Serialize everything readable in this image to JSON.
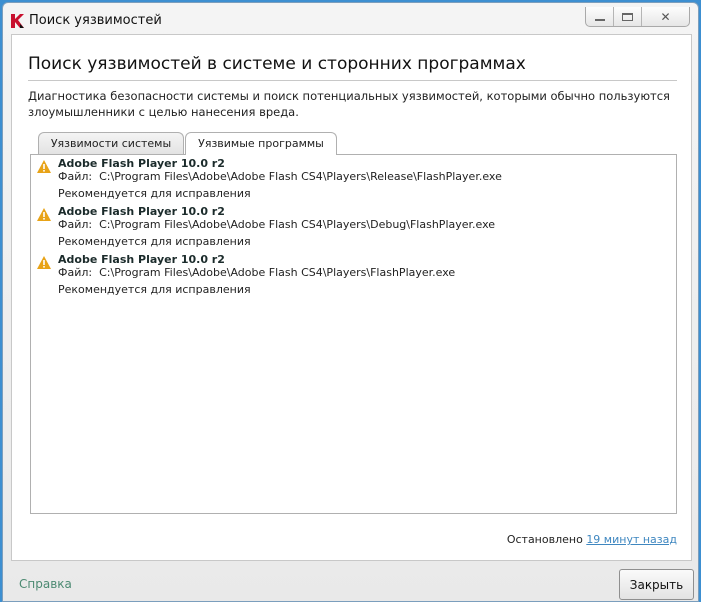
{
  "window": {
    "title": "Поиск уязвимостей"
  },
  "header": {
    "title": "Поиск уязвимостей в системе и сторонних программах",
    "description": "Диагностика безопасности системы и поиск потенциальных уязвимостей, которыми обычно пользуются злоумышленники с целью нанесения вреда."
  },
  "tabs": [
    {
      "label": "Уязвимости системы"
    },
    {
      "label": "Уязвимые программы",
      "active": true
    }
  ],
  "items": [
    {
      "name": "Adobe Flash Player 10.0 r2",
      "file_label": "Файл:",
      "path": "C:\\Program Files\\Adobe\\Adobe Flash CS4\\Players\\Release\\FlashPlayer.exe",
      "status": "Рекомендуется для исправления"
    },
    {
      "name": "Adobe Flash Player 10.0 r2",
      "file_label": "Файл:",
      "path": "C:\\Program Files\\Adobe\\Adobe Flash CS4\\Players\\Debug\\FlashPlayer.exe",
      "status": "Рекомендуется для исправления"
    },
    {
      "name": "Adobe Flash Player 10.0 r2",
      "file_label": "Файл:",
      "path": "C:\\Program Files\\Adobe\\Adobe Flash CS4\\Players\\FlashPlayer.exe",
      "status": "Рекомендуется для исправления"
    }
  ],
  "footer": {
    "status_prefix": "Остановлено",
    "status_link": "19 минут назад",
    "help": "Справка",
    "close": "Закрыть"
  }
}
